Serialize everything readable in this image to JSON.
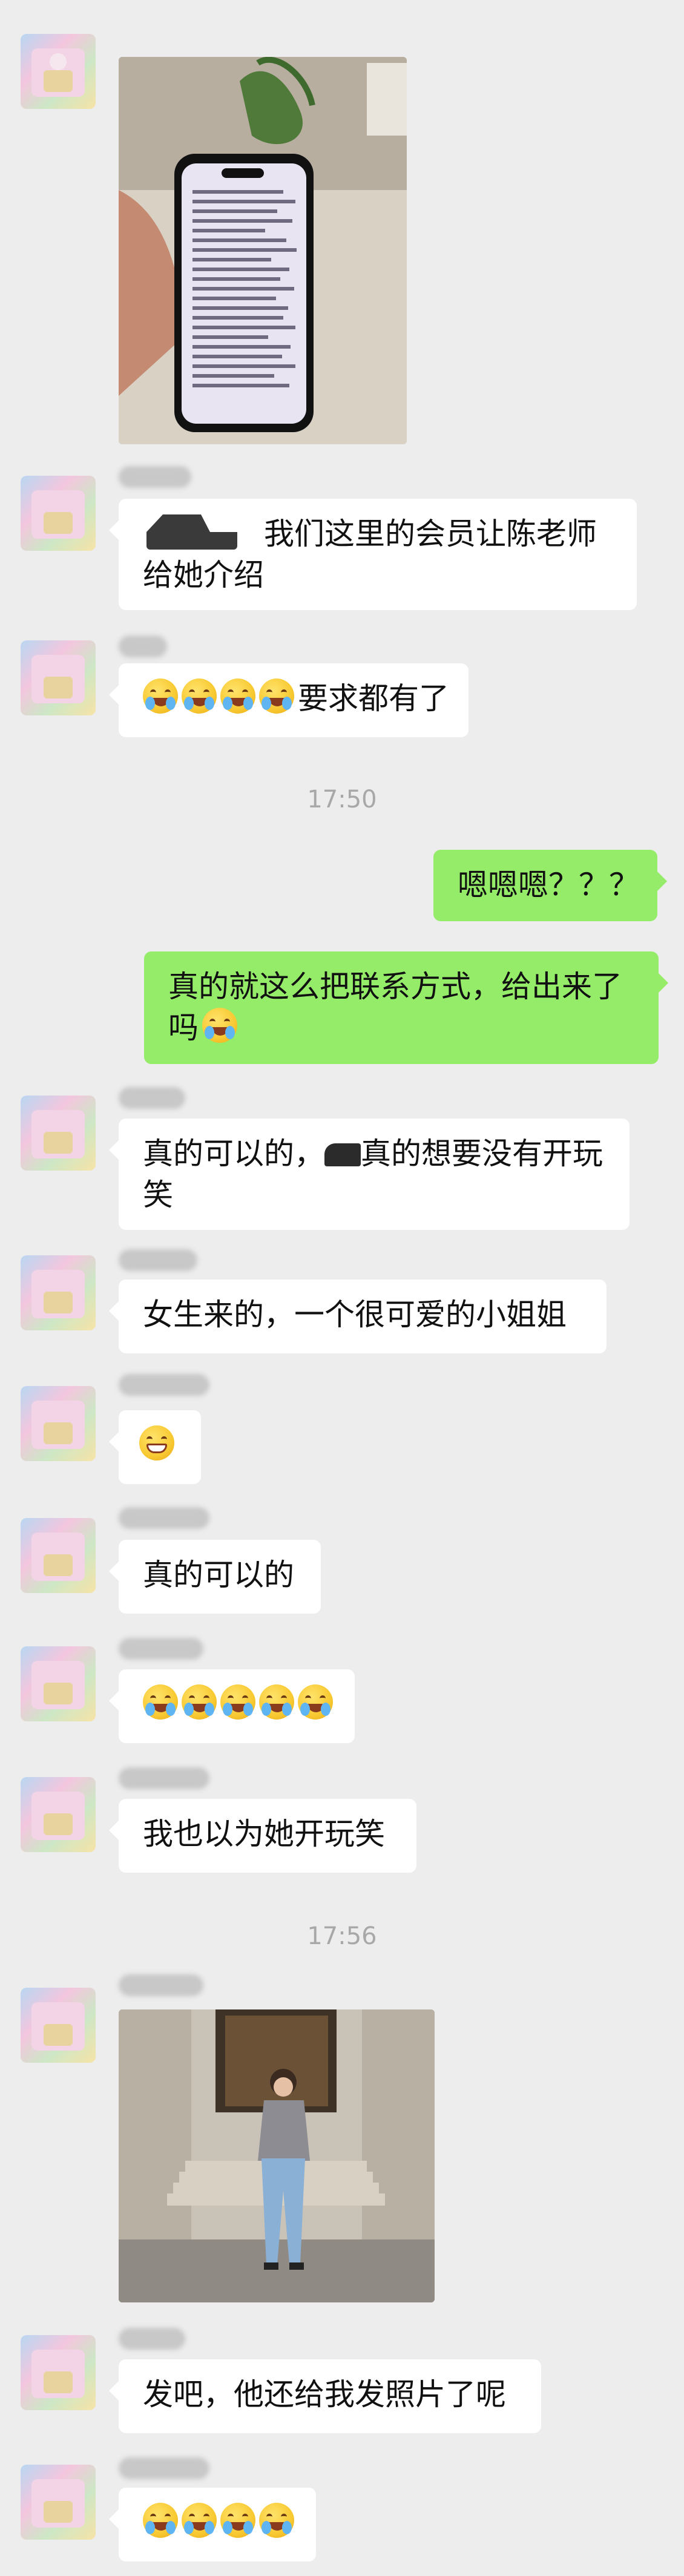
{
  "messages": [
    {
      "type": "image",
      "side": "left",
      "alt": "phone showing text"
    },
    {
      "type": "text",
      "side": "left",
      "text": "我们这里的会员让陈老师",
      "text2": "给她介绍"
    },
    {
      "type": "text",
      "side": "left",
      "emoji_count": 4,
      "text": "要求都有了"
    },
    {
      "type": "time",
      "text": "17:50"
    },
    {
      "type": "text",
      "side": "right",
      "text": "嗯嗯嗯？？？"
    },
    {
      "type": "text",
      "side": "right",
      "text": "真的就这么把联系方式，给出来了",
      "text2": "吗"
    },
    {
      "type": "text",
      "side": "left",
      "text": "真的可以的，",
      "text_b": "真的想要没有开玩",
      "text2": "笑"
    },
    {
      "type": "text",
      "side": "left",
      "text": "女生来的，一个很可爱的小姐姐"
    },
    {
      "type": "emoji",
      "side": "left",
      "emoji": "grin"
    },
    {
      "type": "text",
      "side": "left",
      "text": "真的可以的"
    },
    {
      "type": "emoji",
      "side": "left",
      "emoji_count": 5
    },
    {
      "type": "text",
      "side": "left",
      "text": "我也以为她开玩笑"
    },
    {
      "type": "time",
      "text": "17:56"
    },
    {
      "type": "image",
      "side": "left",
      "alt": "woman standing on steps"
    },
    {
      "type": "text",
      "side": "left",
      "text": "发吧，他还给我发照片了呢"
    },
    {
      "type": "emoji",
      "side": "left",
      "emoji_count": 4
    }
  ],
  "colors": {
    "bg": "#ededed",
    "left_bubble": "#ffffff",
    "right_bubble": "#95ec69"
  },
  "icons": {
    "laugh_cry": "face-with-tears-of-joy",
    "grin": "grinning-face-emoji"
  }
}
